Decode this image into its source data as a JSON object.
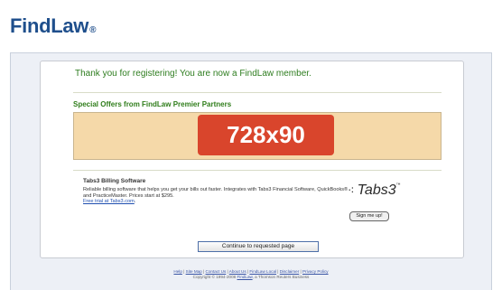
{
  "header": {
    "logo_text": "FindLaw",
    "logo_mark": "®"
  },
  "confirmation": {
    "message": "Thank you for registering! You are now a FindLaw member."
  },
  "offers": {
    "title": "Special Offers from FindLaw Premier Partners",
    "banner_text": "728x90"
  },
  "ad": {
    "title": "Tabs3 Billing Software",
    "description": "Reliable billing software that helps you get your bills out faster.  Integrates with Tabs3 Financial Software, QuickBooks® and PracticeMaster.  Prices start at $295.",
    "link_text": "Free trial at Tabs3.com",
    "link_suffix": ".",
    "logo_text": "Tabs3",
    "logo_tm": "™",
    "signup_label": "Sign me up!"
  },
  "continue_label": "Continue to requested page",
  "footer": {
    "links": [
      "Help",
      "Site Map",
      "Contact Us",
      "About Us",
      "FindLaw Local",
      "Disclaimer",
      "Privacy Policy"
    ],
    "copyright_prefix": "Copyright © 1994-2008",
    "copyright_link": "FindLaw",
    "copyright_suffix": ", a Thomson Reuters Business"
  },
  "colors": {
    "brand": "#1f4f8c",
    "accent_green": "#2e7d1f",
    "banner_red": "#d9452c",
    "banner_bg": "#f5d9a9"
  }
}
